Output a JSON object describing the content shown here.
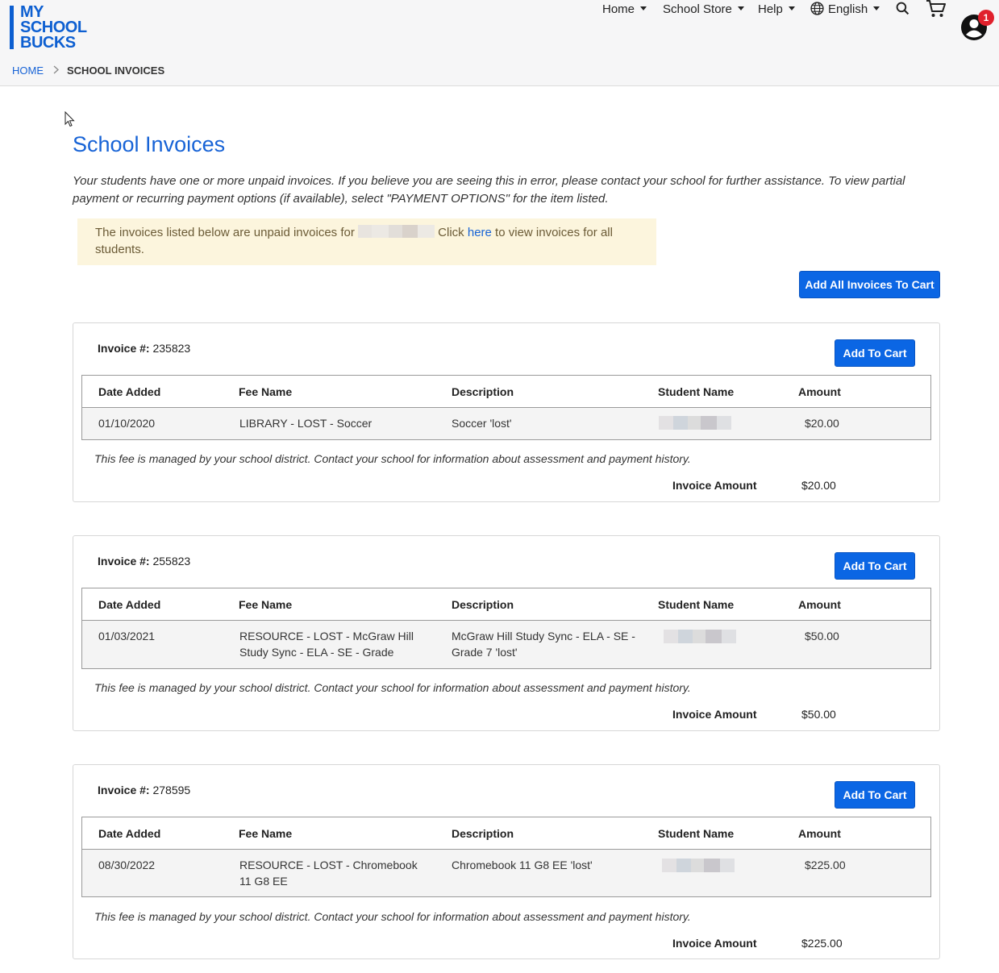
{
  "header": {
    "logo_lines": "MY\nSCHOOL\nBUCKS",
    "nav": [
      {
        "label": "Home"
      },
      {
        "label": "School Store"
      },
      {
        "label": "Help"
      },
      {
        "label": "English"
      }
    ],
    "icons": [
      "globe-icon",
      "search-icon",
      "cart-icon",
      "account-icon"
    ],
    "notification_count": "1"
  },
  "breadcrumb": {
    "home": "HOME",
    "current": "SCHOOL INVOICES"
  },
  "page": {
    "title": "School Invoices",
    "intro": "Your students have one or more unpaid invoices. If you believe you are seeing this in error, please contact your school for further assistance. To view partial payment or recurring payment options (if available), select \"PAYMENT OPTIONS\" for the item listed.",
    "notice_before": "The invoices listed below are unpaid invoices for",
    "notice_middle": " Click ",
    "notice_link": "here",
    "notice_after": " to view invoices for all students.",
    "add_all_label": "Add All Invoices To Cart"
  },
  "table_headers": [
    "Date Added",
    "Fee Name",
    "Description",
    "Student Name",
    "Amount"
  ],
  "invoice_label": "Invoice #:",
  "add_to_cart_label": "Add To Cart",
  "note": "This fee is managed by your school district. Contact your school for information about assessment and payment history.",
  "invoice_amount_label": "Invoice Amount",
  "invoices": [
    {
      "number": "235823",
      "date": "01/10/2020",
      "fee_name": "LIBRARY - LOST - Soccer",
      "description": "Soccer 'lost'",
      "amount": "$20.00",
      "total": "$20.00"
    },
    {
      "number": "255823",
      "date": "01/03/2021",
      "fee_name": "RESOURCE - LOST - McGraw Hill Study Sync - ELA - SE - Grade",
      "description": "McGraw Hill Study Sync - ELA - SE - Grade 7 'lost'",
      "amount": "$50.00",
      "total": "$50.00"
    },
    {
      "number": "278595",
      "date": "08/30/2022",
      "fee_name": "RESOURCE - LOST - Chromebook 11 G8 EE",
      "description": "Chromebook 11 G8 EE 'lost'",
      "amount": "$225.00",
      "total": "$225.00"
    }
  ],
  "colors": {
    "accent": "#1763d6",
    "button": "#0b66e4",
    "notice_bg": "#fcf5dd",
    "badge": "#e0202c"
  }
}
